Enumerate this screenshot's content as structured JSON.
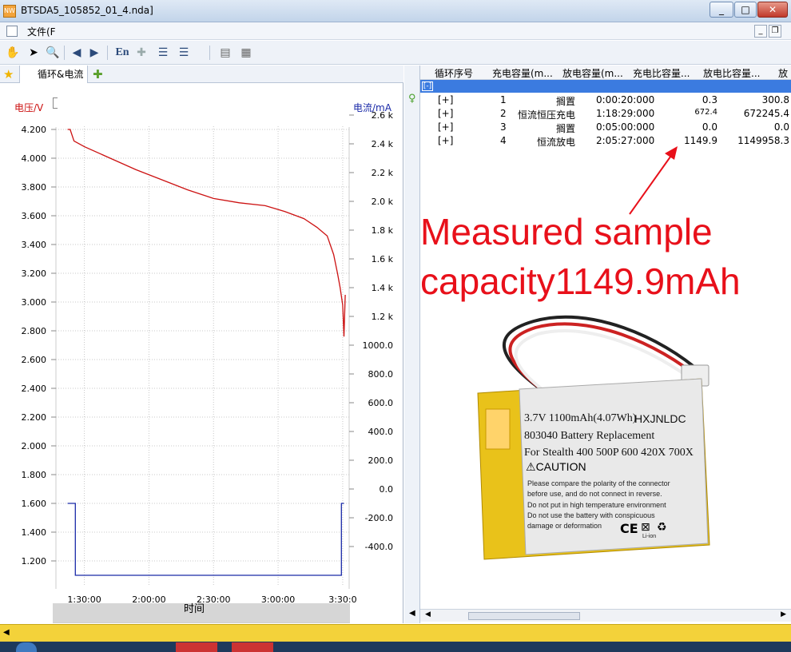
{
  "window": {
    "title": "BTSDA5_105852_01_4.nda]",
    "app_icon_text": "NW"
  },
  "menu": {
    "file_label": "文件(F"
  },
  "toolbar": {
    "en_label": "En"
  },
  "tabs": {
    "cycle_current": "循环&电流"
  },
  "chart_data": {
    "type": "line",
    "xlabel": "时间",
    "y_left_label": "电压/V",
    "y_right_label": "电流/mA",
    "y_left_ticks": [
      "4.200",
      "4.000",
      "3.800",
      "3.600",
      "3.400",
      "3.200",
      "3.000",
      "2.800",
      "2.600",
      "2.400",
      "2.200",
      "2.000",
      "1.800",
      "1.600",
      "1.400",
      "1.200"
    ],
    "y_right_ticks": [
      "2.6 k",
      "2.4 k",
      "2.2 k",
      "2.0 k",
      "1.8 k",
      "1.6 k",
      "1.4 k",
      "1.2 k",
      "1000.0",
      "800.0",
      "600.0",
      "400.0",
      "200.0",
      "0.0",
      "-200.0",
      "-400.0"
    ],
    "x_ticks": [
      "1:30:00",
      "2:00:00",
      "2:30:00",
      "3:00:00",
      "3:30:0"
    ],
    "series": [
      {
        "name": "电压/V",
        "color": "#cc1111",
        "x": [
          1.37,
          1.39,
          1.42,
          1.5,
          1.7,
          1.9,
          2.1,
          2.3,
          2.5,
          2.7,
          2.9,
          3.05,
          3.2,
          3.3,
          3.38,
          3.43,
          3.46,
          3.48,
          3.5,
          3.51,
          3.52
        ],
        "y": [
          4.2,
          4.2,
          4.12,
          4.08,
          4.0,
          3.92,
          3.85,
          3.78,
          3.72,
          3.69,
          3.67,
          3.63,
          3.58,
          3.52,
          3.46,
          3.33,
          3.2,
          3.1,
          2.98,
          2.76,
          3.05
        ]
      },
      {
        "name": "电流/mA",
        "color": "#1a2aa8",
        "x": [
          1.37,
          1.43,
          1.43,
          3.49,
          3.49,
          3.51
        ],
        "y": [
          0,
          0,
          -500,
          -500,
          0,
          0
        ]
      }
    ]
  },
  "grid": {
    "headers": [
      "循环序号",
      "充电容量(m...",
      "放电容量(m...",
      "充电比容量...",
      "放电比容量...",
      "放"
    ],
    "collapse_symbol": "[-]",
    "rows": [
      {
        "expand": "[+]",
        "cycle": "1",
        "step": "搁置",
        "time": "0:00:20:000",
        "charge": "0.3",
        "discharge": "300.8"
      },
      {
        "expand": "[+]",
        "cycle": "2",
        "step": "恒流恒压充电",
        "time": "1:18:29:000",
        "charge": "672.4",
        "discharge": "672245.4"
      },
      {
        "expand": "[+]",
        "cycle": "3",
        "step": "搁置",
        "time": "0:05:00:000",
        "charge": "0.0",
        "discharge": "0.0"
      },
      {
        "expand": "[+]",
        "cycle": "4",
        "step": "恒流放电",
        "time": "2:05:27:000",
        "charge": "1149.9",
        "discharge": "1149958.3"
      }
    ]
  },
  "annotation": {
    "line1": "Measured sample",
    "line2": "capacity1149.9mAh",
    "color": "#e8101a"
  },
  "battery": {
    "line1": "3.7V 1100mAh(4.07Wh)",
    "brand": "HXJNLDC",
    "line2": "803040  Battery Replacement",
    "line3": "For Stealth 400 500P 600 420X 700X",
    "caution": "CAUTION",
    "warn1": "Please compare the polarity of the connector",
    "warn2": "before use, and do not connect in reverse.",
    "warn3": "Do not put in high temperature environment",
    "warn4": "Do not use the battery with conspicuous",
    "warn5": "damage or deformation",
    "marks": "CE",
    "li_ion": "Li-ion"
  }
}
